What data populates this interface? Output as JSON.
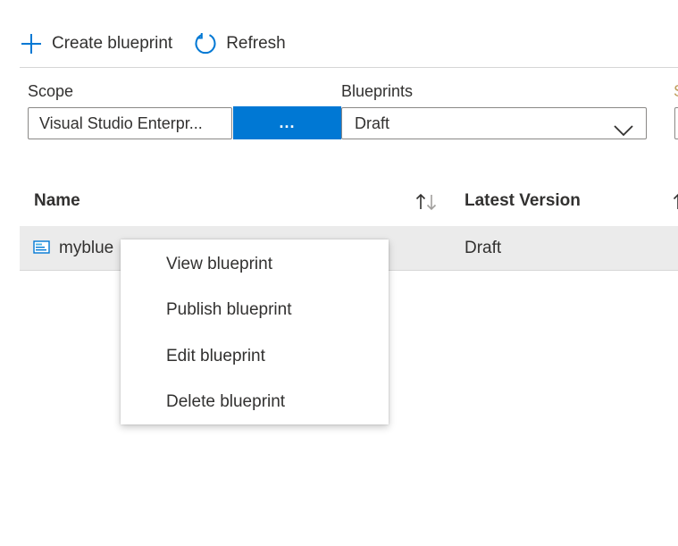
{
  "toolbar": {
    "create_label": "Create blueprint",
    "create_icon": "plus-icon",
    "refresh_label": "Refresh",
    "refresh_icon": "refresh-icon"
  },
  "filters": {
    "scope_label": "Scope",
    "scope_value": "Visual Studio Enterpr...",
    "scope_button_label": "...",
    "blueprints_label": "Blueprints",
    "blueprints_value": "Draft"
  },
  "table": {
    "columns": [
      "Name",
      "Latest Version"
    ],
    "rows": [
      {
        "name": "myblue",
        "latest_version": "Draft",
        "icon": "blueprint-icon"
      }
    ]
  },
  "context_menu": {
    "items": [
      "View blueprint",
      "Publish blueprint",
      "Edit blueprint",
      "Delete blueprint"
    ]
  },
  "colors": {
    "accent": "#0078d4",
    "row_selected": "#ebebeb",
    "text": "#323130",
    "border": "#8a8886"
  }
}
